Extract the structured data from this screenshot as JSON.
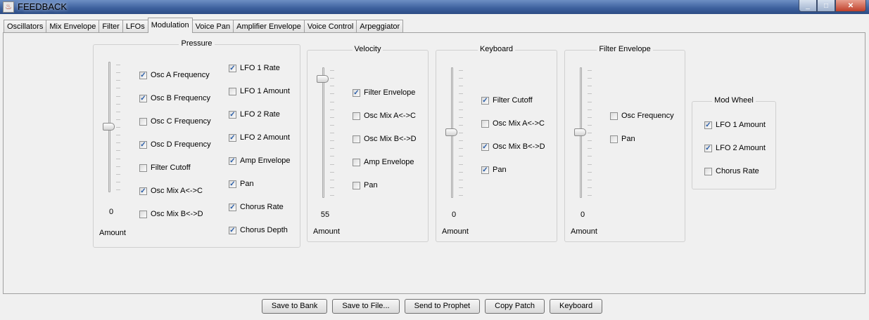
{
  "window": {
    "title": "FEEDBACK",
    "controls": [
      "_",
      "□",
      "✕"
    ]
  },
  "tabs": [
    "Oscillators",
    "Mix Envelope",
    "Filter",
    "LFOs",
    "Modulation",
    "Voice Pan",
    "Amplifier Envelope",
    "Voice Control",
    "Arpeggiator"
  ],
  "active_tab": "Modulation",
  "amount_label": "Amount",
  "pressure": {
    "title": "Pressure",
    "value": "0",
    "level": 0,
    "left_checks": [
      {
        "label": "Osc A Frequency",
        "checked": true
      },
      {
        "label": "Osc B Frequency",
        "checked": true
      },
      {
        "label": "Osc C Frequency",
        "checked": false
      },
      {
        "label": "Osc D Frequency",
        "checked": true
      },
      {
        "label": "Filter Cutoff",
        "checked": false
      },
      {
        "label": "Osc Mix A<->C",
        "checked": true
      },
      {
        "label": "Osc Mix B<->D",
        "checked": false
      }
    ],
    "right_checks": [
      {
        "label": "LFO 1 Rate",
        "checked": true
      },
      {
        "label": "LFO 1 Amount",
        "checked": false
      },
      {
        "label": "LFO 2 Rate",
        "checked": true
      },
      {
        "label": "LFO 2 Amount",
        "checked": true
      },
      {
        "label": "Amp Envelope",
        "checked": true
      },
      {
        "label": "Pan",
        "checked": true
      },
      {
        "label": "Chorus Rate",
        "checked": true
      },
      {
        "label": "Chorus Depth",
        "checked": true
      }
    ]
  },
  "velocity": {
    "title": "Velocity",
    "value": "55",
    "level": 55,
    "checks": [
      {
        "label": "Filter Envelope",
        "checked": true
      },
      {
        "label": "Osc Mix A<->C",
        "checked": false
      },
      {
        "label": "Osc Mix B<->D",
        "checked": false
      },
      {
        "label": "Amp Envelope",
        "checked": false
      },
      {
        "label": "Pan",
        "checked": false
      }
    ]
  },
  "keyboard": {
    "title": "Keyboard",
    "value": "0",
    "level": 0,
    "checks": [
      {
        "label": "Filter Cutoff",
        "checked": true
      },
      {
        "label": "Osc Mix A<->C",
        "checked": false
      },
      {
        "label": "Osc Mix B<->D",
        "checked": true
      },
      {
        "label": "Pan",
        "checked": true
      }
    ]
  },
  "filter_envelope": {
    "title": "Filter Envelope",
    "value": "0",
    "level": 0,
    "checks": [
      {
        "label": "Osc Frequency",
        "checked": false
      },
      {
        "label": "Pan",
        "checked": false
      }
    ]
  },
  "mod_wheel": {
    "title": "Mod Wheel",
    "checks": [
      {
        "label": "LFO 1 Amount",
        "checked": true
      },
      {
        "label": "LFO 2 Amount",
        "checked": true
      },
      {
        "label": "Chorus Rate",
        "checked": false
      }
    ]
  },
  "buttons": [
    "Save to Bank",
    "Save to File...",
    "Send to Prophet",
    "Copy Patch",
    "Keyboard"
  ]
}
